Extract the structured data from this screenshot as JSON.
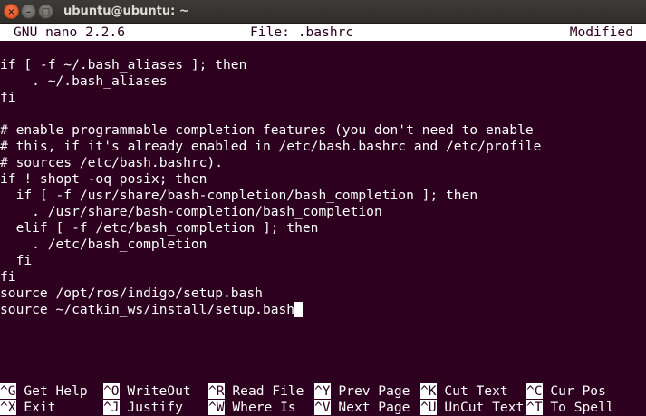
{
  "window": {
    "title": "ubuntu@ubuntu: ~",
    "buttons": {
      "close": "×",
      "minimize": "–",
      "maximize": "□"
    }
  },
  "nano": {
    "version": "GNU nano 2.2.6",
    "file": "File: .bashrc",
    "status": "Modified"
  },
  "lines": [
    "if [ -f ~/.bash_aliases ]; then",
    "    . ~/.bash_aliases",
    "fi",
    "",
    "# enable programmable completion features (you don't need to enable",
    "# this, if it's already enabled in /etc/bash.bashrc and /etc/profile",
    "# sources /etc/bash.bashrc).",
    "if ! shopt -oq posix; then",
    "  if [ -f /usr/share/bash-completion/bash_completion ]; then",
    "    . /usr/share/bash-completion/bash_completion",
    "  elif [ -f /etc/bash_completion ]; then",
    "    . /etc/bash_completion",
    "  fi",
    "fi",
    "source /opt/ros/indigo/setup.bash",
    "source ~/catkin_ws/install/setup.bash"
  ],
  "shortcuts_row1": [
    {
      "key": "^G",
      "label": "Get Help"
    },
    {
      "key": "^O",
      "label": "WriteOut"
    },
    {
      "key": "^R",
      "label": "Read File"
    },
    {
      "key": "^Y",
      "label": "Prev Page"
    },
    {
      "key": "^K",
      "label": "Cut Text"
    },
    {
      "key": "^C",
      "label": "Cur Pos"
    }
  ],
  "shortcuts_row2": [
    {
      "key": "^X",
      "label": "Exit"
    },
    {
      "key": "^J",
      "label": "Justify"
    },
    {
      "key": "^W",
      "label": "Where Is"
    },
    {
      "key": "^V",
      "label": "Next Page"
    },
    {
      "key": "^U",
      "label": "UnCut Text"
    },
    {
      "key": "^T",
      "label": "To Spell"
    }
  ],
  "colors": {
    "terminal_bg": "#2c001e",
    "text": "#ffffff",
    "titlebar": "#3c3b37",
    "close_button": "#e9541f"
  }
}
